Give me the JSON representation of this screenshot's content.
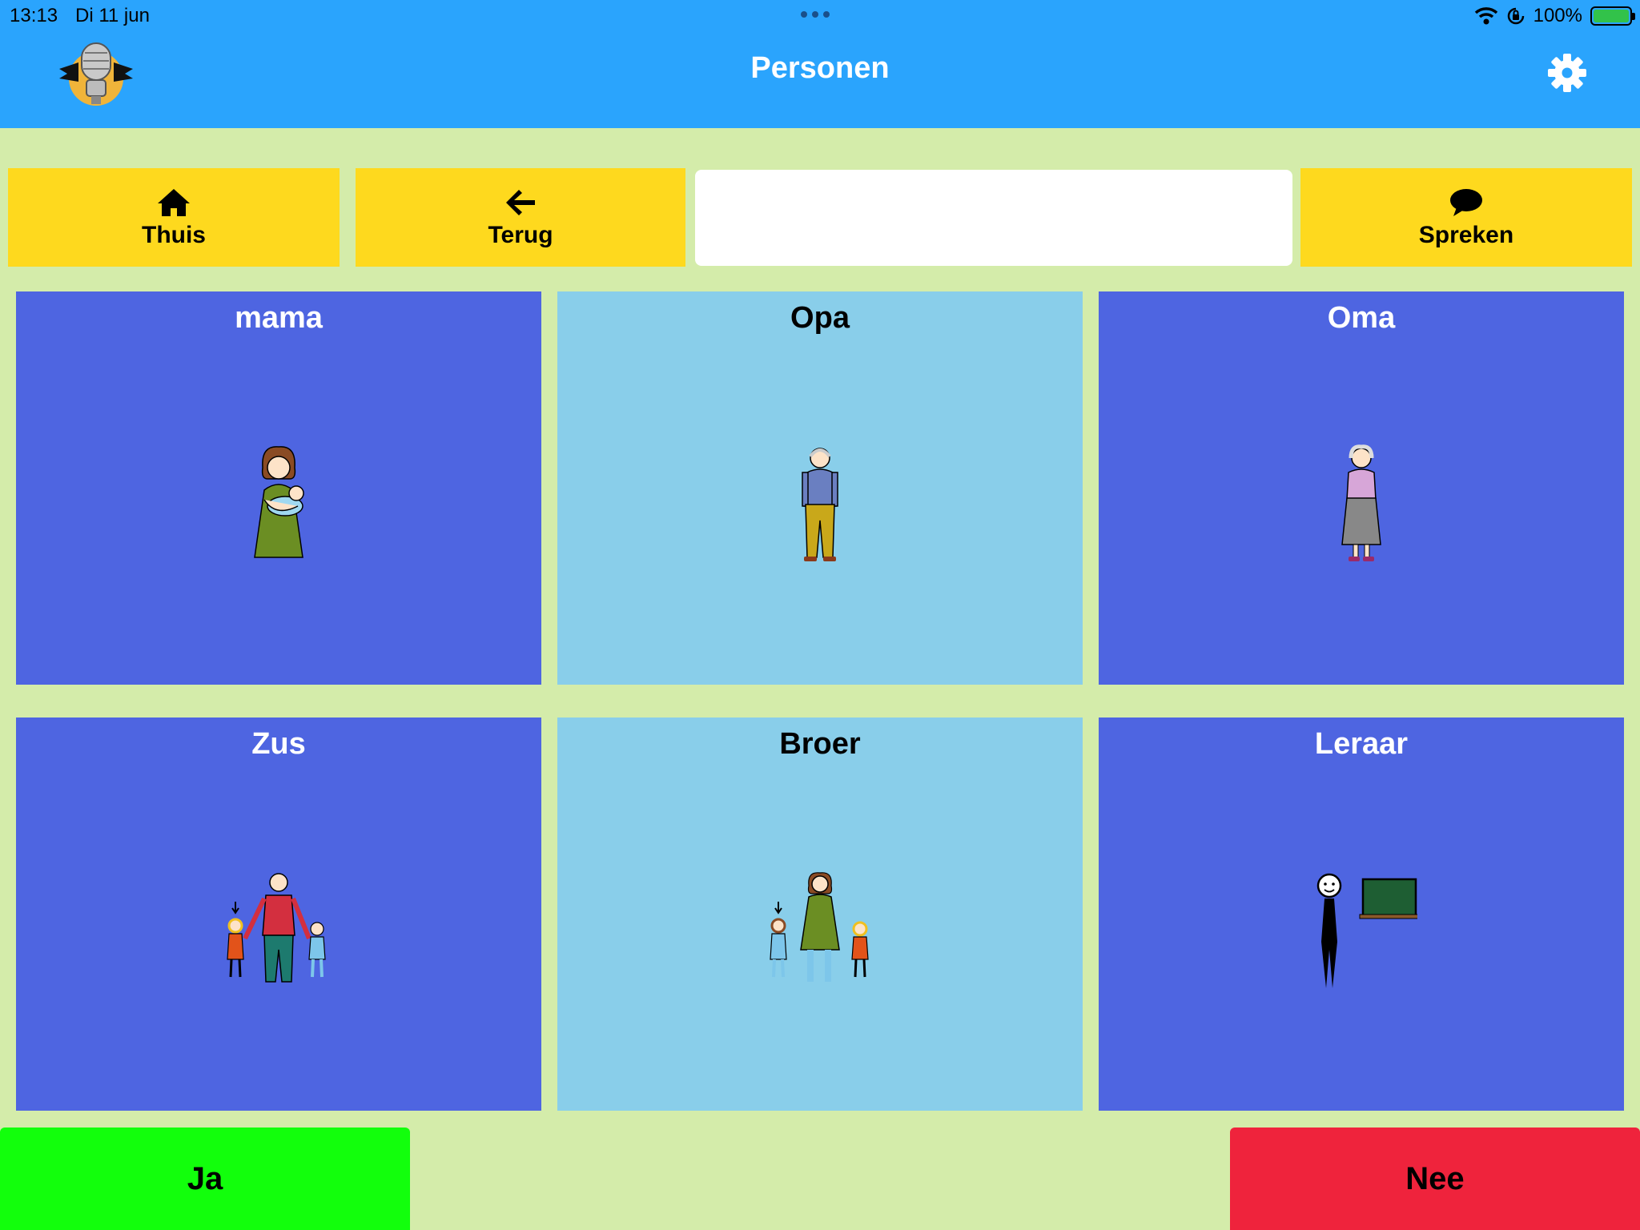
{
  "status_bar": {
    "time": "13:13",
    "date": "Di 11 jun",
    "battery": "100%"
  },
  "header": {
    "title": "Personen"
  },
  "toolbar": {
    "home_label": "Thuis",
    "back_label": "Terug",
    "speak_label": "Spreken",
    "message": ""
  },
  "tiles": [
    {
      "label": "mama",
      "icon": "mother-baby-icon",
      "style": "dark"
    },
    {
      "label": "Opa",
      "icon": "grandfather-icon",
      "style": "light"
    },
    {
      "label": "Oma",
      "icon": "grandmother-icon",
      "style": "dark"
    },
    {
      "label": "Zus",
      "icon": "sister-icon",
      "style": "dark"
    },
    {
      "label": "Broer",
      "icon": "brother-icon",
      "style": "light"
    },
    {
      "label": "Leraar",
      "icon": "teacher-icon",
      "style": "dark"
    }
  ],
  "answers": {
    "yes_label": "Ja",
    "no_label": "Nee"
  },
  "colors": {
    "header": "#2aa4fd",
    "background": "#d4ecaa",
    "toolbar_button": "#fed91e",
    "tile_dark": "#4e65e1",
    "tile_light": "#89ceea",
    "yes": "#12ff0c",
    "no": "#ef233c"
  }
}
